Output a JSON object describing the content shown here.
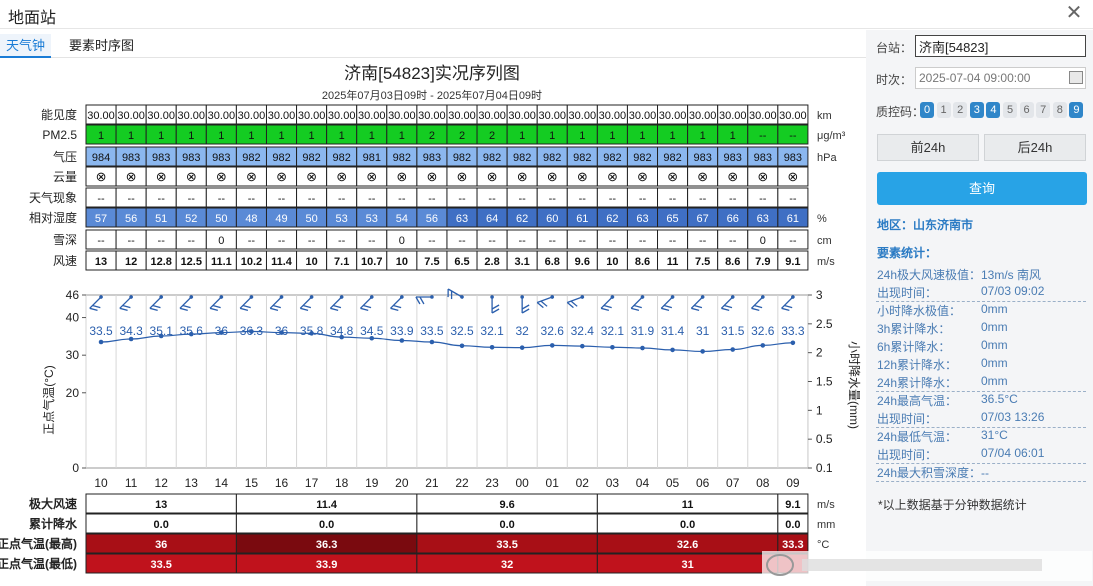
{
  "window": {
    "title": "地面站",
    "close_icon": "close-icon"
  },
  "tabs": [
    {
      "label": "天气钟",
      "active": true
    },
    {
      "label": "要素时序图",
      "active": false
    }
  ],
  "chart_data": {
    "type": "line",
    "title": "济南[54823]实况序列图",
    "subtitle": "2025年07月03日09时 - 2025年07月04日09时",
    "x": [
      "10",
      "11",
      "12",
      "13",
      "14",
      "15",
      "16",
      "17",
      "18",
      "19",
      "20",
      "21",
      "22",
      "23",
      "00",
      "01",
      "02",
      "03",
      "04",
      "05",
      "06",
      "07",
      "08",
      "09"
    ],
    "rows": [
      {
        "label": "能见度",
        "unit": "km",
        "style": "white",
        "values": [
          "30.00",
          "30.00",
          "30.00",
          "30.00",
          "30.00",
          "30.00",
          "30.00",
          "30.00",
          "30.00",
          "30.00",
          "30.00",
          "30.00",
          "30.00",
          "30.00",
          "30.00",
          "30.00",
          "30.00",
          "30.00",
          "30.00",
          "30.00",
          "30.00",
          "30.00",
          "30.00",
          "30.00"
        ]
      },
      {
        "label": "PM2.5",
        "unit": "μg/m³",
        "style": "pm",
        "values": [
          "1",
          "1",
          "1",
          "1",
          "1",
          "1",
          "1",
          "1",
          "1",
          "1",
          "1",
          "2",
          "2",
          "2",
          "1",
          "1",
          "1",
          "1",
          "1",
          "1",
          "1",
          "1",
          "--",
          "--"
        ]
      },
      {
        "label": "气压",
        "unit": "hPa",
        "style": "press",
        "values": [
          "984",
          "983",
          "983",
          "983",
          "983",
          "982",
          "982",
          "982",
          "982",
          "981",
          "982",
          "983",
          "982",
          "982",
          "982",
          "982",
          "982",
          "982",
          "982",
          "982",
          "983",
          "983",
          "983",
          "983"
        ]
      },
      {
        "label": "云量",
        "unit": "",
        "style": "cloud",
        "values": [
          "⊗",
          "⊗",
          "⊗",
          "⊗",
          "⊗",
          "⊗",
          "⊗",
          "⊗",
          "⊗",
          "⊗",
          "⊗",
          "⊗",
          "⊗",
          "⊗",
          "⊗",
          "⊗",
          "⊗",
          "⊗",
          "⊗",
          "⊗",
          "⊗",
          "⊗",
          "⊗",
          "⊗"
        ]
      },
      {
        "label": "天气现象",
        "unit": "",
        "style": "white",
        "values": [
          "--",
          "--",
          "--",
          "--",
          "--",
          "--",
          "--",
          "--",
          "--",
          "--",
          "--",
          "--",
          "--",
          "--",
          "--",
          "--",
          "--",
          "--",
          "--",
          "--",
          "--",
          "--",
          "--",
          "--"
        ]
      },
      {
        "label": "相对湿度",
        "unit": "%",
        "style": "rh",
        "values": [
          "57",
          "56",
          "51",
          "52",
          "50",
          "48",
          "49",
          "50",
          "53",
          "53",
          "54",
          "56",
          "63",
          "64",
          "62",
          "60",
          "61",
          "62",
          "63",
          "65",
          "67",
          "66",
          "63",
          "61"
        ]
      },
      {
        "label": "雪深",
        "unit": "cm",
        "style": "white",
        "values": [
          "--",
          "--",
          "--",
          "--",
          "0",
          "--",
          "--",
          "--",
          "--",
          "--",
          "0",
          "--",
          "--",
          "--",
          "--",
          "--",
          "--",
          "--",
          "--",
          "--",
          "--",
          "--",
          "0",
          "--"
        ]
      },
      {
        "label": "风速",
        "unit": "m/s",
        "style": "white",
        "values": [
          "13",
          "12",
          "12.8",
          "12.5",
          "11.1",
          "10.2",
          "11.4",
          "10",
          "7.1",
          "10.7",
          "10",
          "7.5",
          "6.5",
          "2.8",
          "3.1",
          "6.8",
          "9.6",
          "10",
          "8.6",
          "11",
          "7.5",
          "8.6",
          "7.9",
          "9.1"
        ]
      }
    ],
    "temperature": {
      "ylabel": "正点气温(°C)",
      "ylim": [
        0,
        46
      ],
      "yticks": [
        "0",
        "20",
        "30",
        "40",
        "46"
      ],
      "values": [
        33.5,
        34.3,
        35.1,
        35.6,
        36,
        36.3,
        36,
        35.8,
        34.8,
        34.5,
        33.9,
        33.5,
        32.5,
        32.1,
        32,
        32.6,
        32.4,
        32.1,
        31.9,
        31.4,
        31,
        31.5,
        32.6,
        33.3
      ],
      "labels": [
        "33.5",
        "34.3",
        "35.1",
        "35.6",
        "36",
        "36.3",
        "36",
        "35.8",
        "34.8",
        "34.5",
        "33.9",
        "33.5",
        "32.5",
        "32.1",
        "32",
        "32.6",
        "32.4",
        "32.1",
        "31.9",
        "31.4",
        "31",
        "31.5",
        "32.6",
        "33.3"
      ]
    },
    "precip_axis": {
      "ylabel": "小时降水量(mm)",
      "yticks": [
        "0.1",
        "0.5",
        "1",
        "1.5",
        "2",
        "2.5",
        "3"
      ]
    },
    "wind_directions_deg": [
      225,
      225,
      225,
      225,
      225,
      225,
      225,
      225,
      225,
      225,
      225,
      270,
      300,
      180,
      180,
      250,
      250,
      225,
      225,
      225,
      225,
      225,
      225,
      225
    ],
    "bottom_rows": [
      {
        "label": "极大风速",
        "unit": "m/s",
        "style": "white",
        "segments": [
          "13",
          "11.4",
          "9.6",
          "11",
          "9.1"
        ]
      },
      {
        "label": "累计降水",
        "unit": "mm",
        "style": "white",
        "segments": [
          "0.0",
          "0.0",
          "0.0",
          "0.0",
          "0.0"
        ]
      },
      {
        "label": "正点气温(最高)",
        "unit": "°C",
        "style": "hi",
        "segments": [
          "36",
          "36.3",
          "33.5",
          "32.6",
          "33.3"
        ]
      },
      {
        "label": "正点气温(最低)",
        "unit": "",
        "style": "lo",
        "segments": [
          "33.5",
          "33.9",
          "32",
          "31",
          ""
        ]
      }
    ]
  },
  "sidebar": {
    "station_label": "台站：",
    "station_value": "济南[54823]",
    "time_label": "时次：",
    "time_value": "2025-07-04 09:00:00",
    "qc_label": "质控码：",
    "qc_codes": [
      {
        "code": "0",
        "on": true
      },
      {
        "code": "1",
        "on": false
      },
      {
        "code": "2",
        "on": false
      },
      {
        "code": "3",
        "on": true
      },
      {
        "code": "4",
        "on": true
      },
      {
        "code": "5",
        "on": false
      },
      {
        "code": "6",
        "on": false
      },
      {
        "code": "7",
        "on": false
      },
      {
        "code": "8",
        "on": false
      },
      {
        "code": "9",
        "on": true
      }
    ],
    "prev_button": "前24h",
    "next_button": "后24h",
    "query_button": "查询",
    "region": "地区：山东济南市",
    "stats_title": "要素统计：",
    "stats": [
      {
        "k": "24h极大风速极值：",
        "v": "13m/s 南风",
        "dash": false
      },
      {
        "k": "出现时间：",
        "v": "07/03 09:02",
        "dash": true
      },
      {
        "k": "小时降水极值：",
        "v": "0mm",
        "dash": false
      },
      {
        "k": "3h累计降水：",
        "v": "0mm",
        "dash": false
      },
      {
        "k": "6h累计降水：",
        "v": "0mm",
        "dash": false
      },
      {
        "k": "12h累计降水：",
        "v": "0mm",
        "dash": false
      },
      {
        "k": "24h累计降水：",
        "v": "0mm",
        "dash": true
      },
      {
        "k": "24h最高气温：",
        "v": "36.5°C",
        "dash": false
      },
      {
        "k": "出现时间：",
        "v": "07/03 13:26",
        "dash": true
      },
      {
        "k": "24h最低气温：",
        "v": "31°C",
        "dash": false
      },
      {
        "k": "出现时间：",
        "v": "07/04 06:01",
        "dash": true
      },
      {
        "k": "24h最大积雪深度：--",
        "v": "",
        "dash": true
      }
    ],
    "note": "*以上数据基于分钟数据统计"
  },
  "colors": {
    "pm_green": "#14cc22",
    "press_blue": "#8bb7ef",
    "rh_blue": "#4f7fd0",
    "hi_red": "#a80f16",
    "lo_red": "#c0121c",
    "line_blue": "#2b5fad",
    "accent": "#28a3e6"
  }
}
